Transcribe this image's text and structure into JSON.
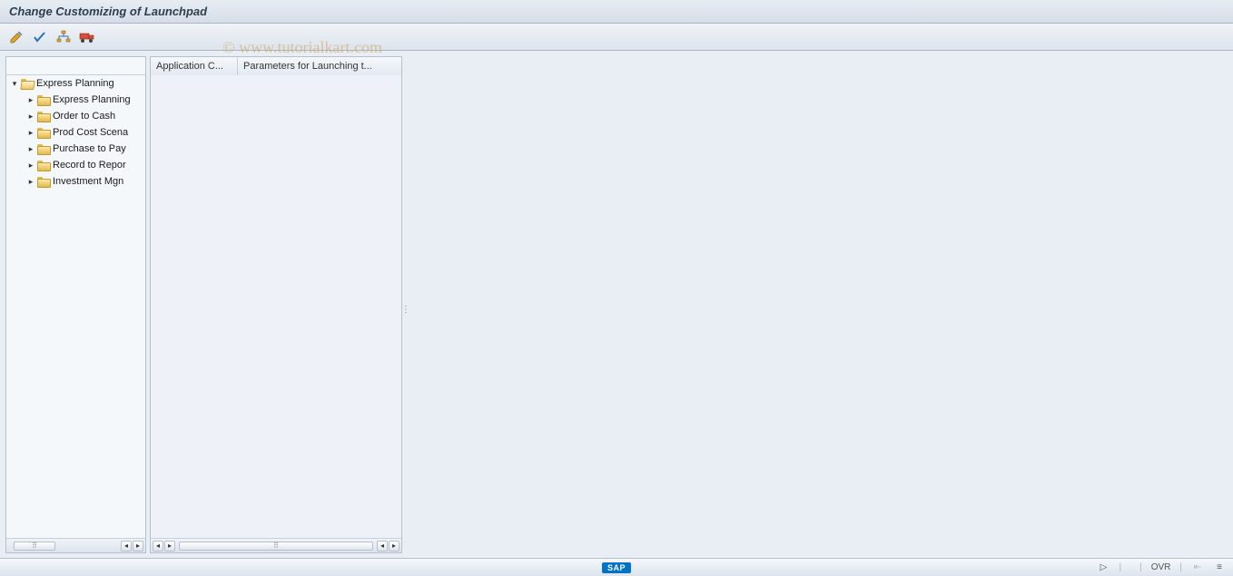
{
  "title": "Change Customizing of Launchpad",
  "toolbar": {
    "icons": [
      "pencil-icon",
      "check-icon",
      "hierarchy-icon",
      "transport-icon"
    ]
  },
  "columns": {
    "app_category": "Application C...",
    "parameters": "Parameters for Launching t..."
  },
  "tree": {
    "root": "Express Planning",
    "children": [
      "Express Planning",
      "Order to Cash",
      "Prod Cost Scena",
      "Purchase to Pay",
      "Record to Repor",
      "Investment Mgn"
    ]
  },
  "watermark": "© www.tutorialkart.com",
  "statusbar": {
    "sap": "SAP",
    "session": "",
    "ovr": "OVR"
  }
}
